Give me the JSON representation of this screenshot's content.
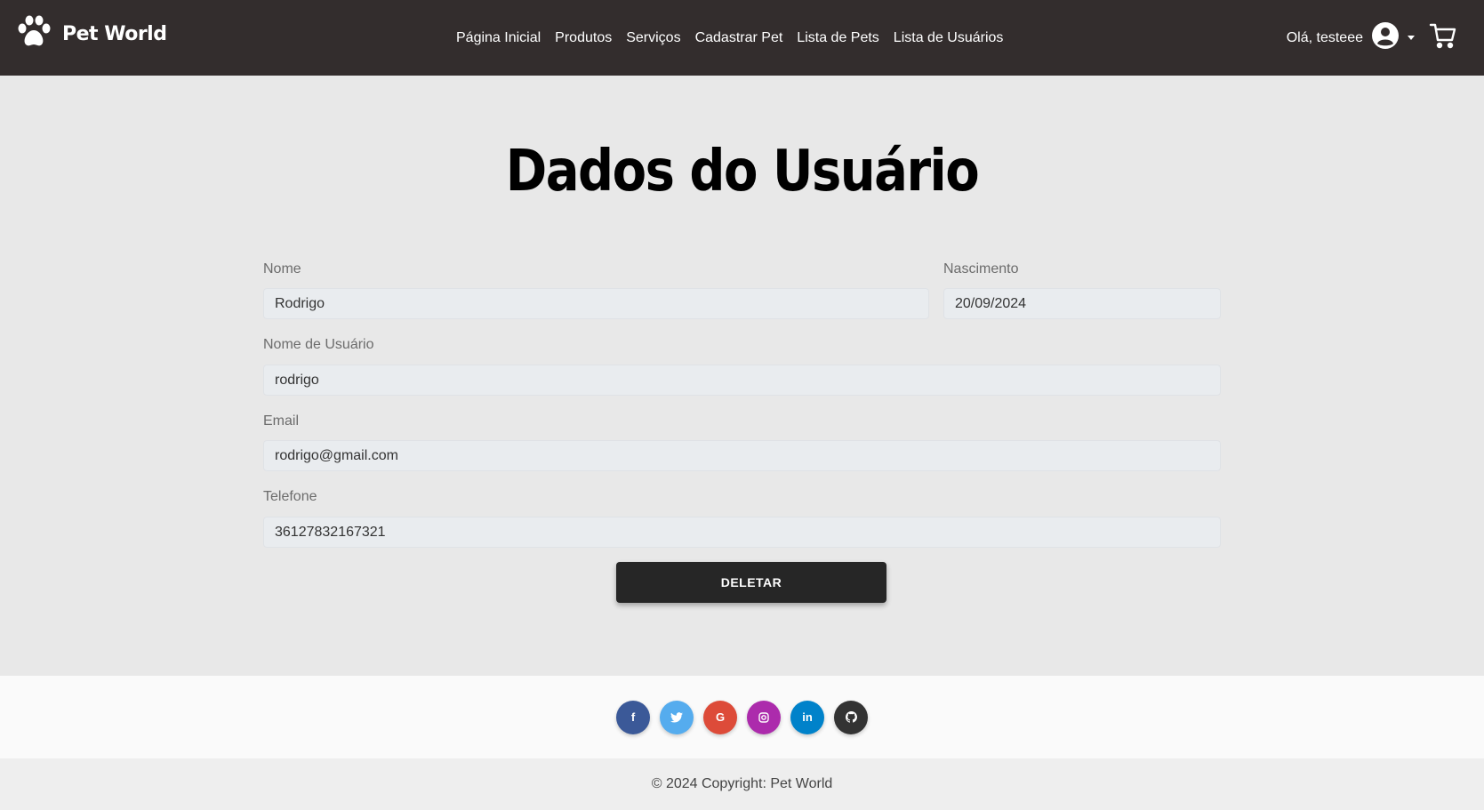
{
  "brand": {
    "name": "Pet World",
    "icon": "paw-icon"
  },
  "nav": {
    "links": [
      "Página Inicial",
      "Produtos",
      "Serviços",
      "Cadastrar Pet",
      "Lista de Pets",
      "Lista de Usuários"
    ],
    "greeting": "Olá, testeee",
    "user_icon": "user-circle-icon",
    "cart_icon": "cart-icon"
  },
  "page": {
    "title": "Dados do Usuário"
  },
  "form": {
    "nome": {
      "label": "Nome",
      "value": "Rodrigo"
    },
    "nascimento": {
      "label": "Nascimento",
      "value": "20/09/2024"
    },
    "usuario": {
      "label": "Nome de Usuário",
      "value": "rodrigo"
    },
    "email": {
      "label": "Email",
      "value": "rodrigo@gmail.com"
    },
    "telefone": {
      "label": "Telefone",
      "value": "36127832167321"
    },
    "delete_label": "DELETAR"
  },
  "footer": {
    "social": [
      {
        "name": "facebook",
        "glyph": "f",
        "color": "#3b5998"
      },
      {
        "name": "twitter",
        "glyph": "t",
        "color": "#55acee"
      },
      {
        "name": "google",
        "glyph": "G",
        "color": "#dd4b39"
      },
      {
        "name": "instagram",
        "glyph": "◎",
        "color": "#ac2bac"
      },
      {
        "name": "linkedin",
        "glyph": "in",
        "color": "#0082ca"
      },
      {
        "name": "github",
        "glyph": "●",
        "color": "#333333"
      }
    ],
    "copyright": "© 2024 Copyright: Pet World"
  }
}
